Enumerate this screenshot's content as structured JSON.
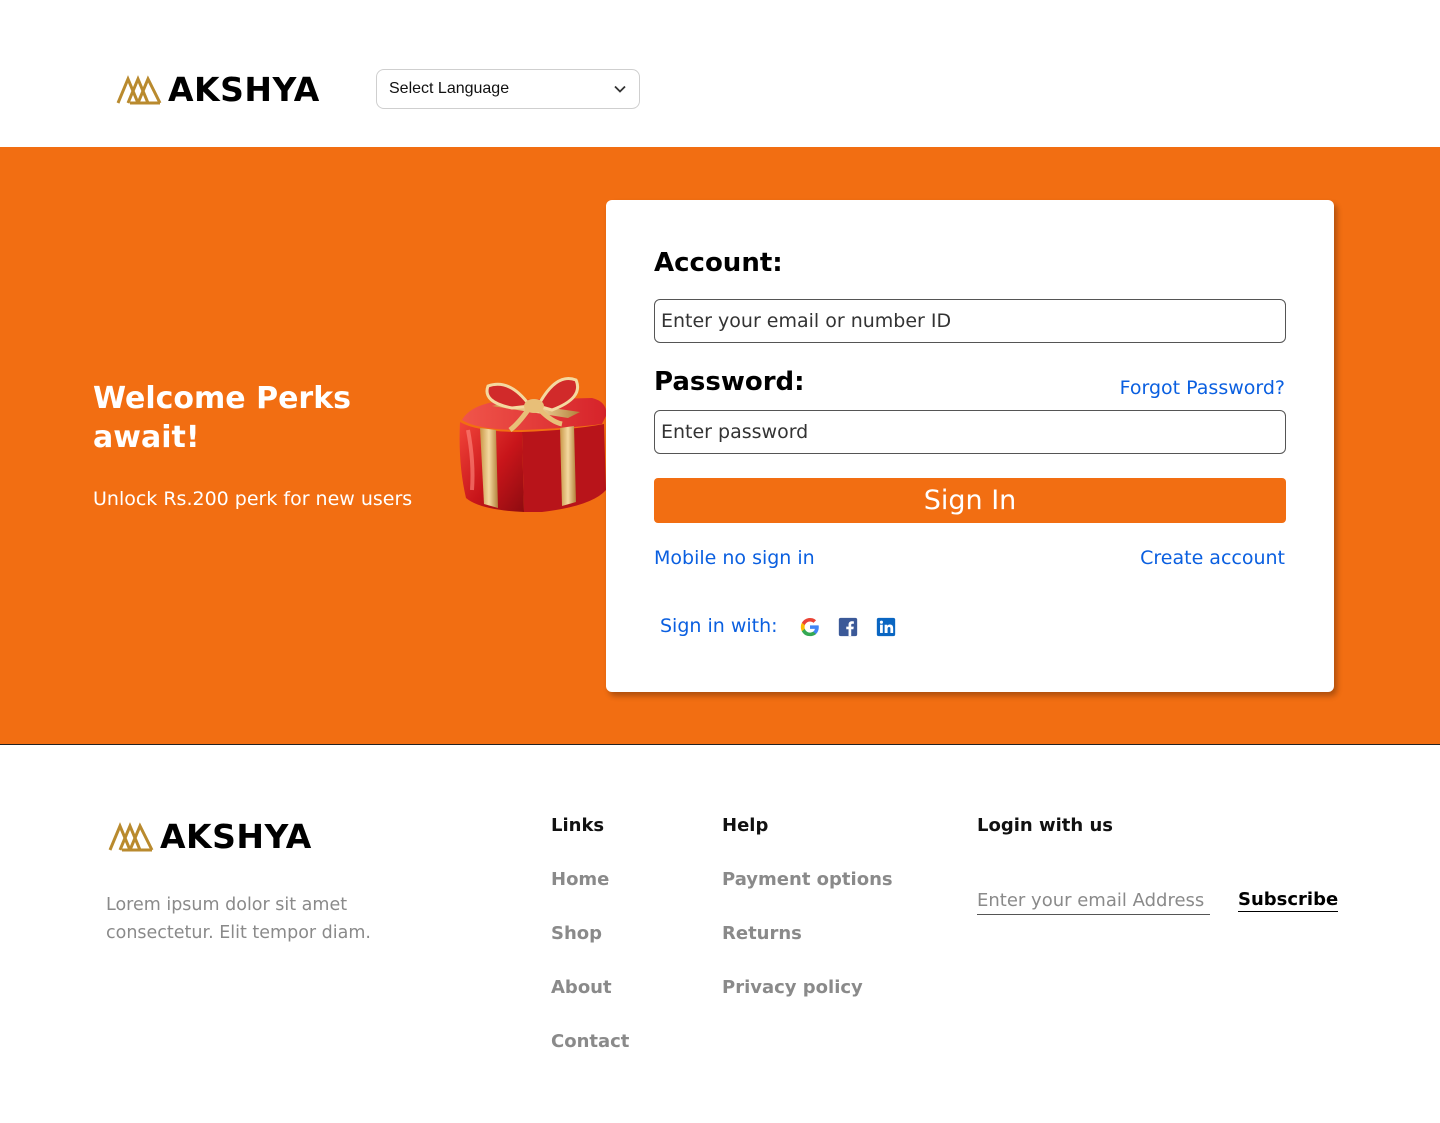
{
  "header": {
    "brand": "AKSHYA",
    "language_select": {
      "selected": "Select Language"
    }
  },
  "hero": {
    "title": "Welcome Perks await!",
    "subtitle": "Unlock Rs.200 perk for new users"
  },
  "login_card": {
    "account_label": "Account:",
    "account_placeholder": "Enter your email or number ID",
    "password_label": "Password:",
    "password_placeholder": "Enter password",
    "forgot_password": "Forgot Password?",
    "sign_in_button": "Sign In",
    "mobile_sign_in": "Mobile no sign in",
    "create_account": "Create account",
    "sign_in_with": "Sign in with:",
    "social_icons": [
      "google-icon",
      "facebook-icon",
      "linkedin-icon"
    ]
  },
  "footer": {
    "brand": "AKSHYA",
    "about": "Lorem ipsum dolor sit amet consectetur. Elit tempor diam.",
    "links_heading": "Links",
    "links": [
      "Home",
      "Shop",
      "About",
      "Contact"
    ],
    "help_heading": "Help",
    "help_links": [
      "Payment options",
      "Returns",
      "Privacy policy"
    ],
    "login_heading": "Login with us",
    "newsletter_placeholder": "Enter your email Address",
    "subscribe": "Subscribe"
  },
  "colors": {
    "accent": "#f26e12",
    "link": "#0a5fe0",
    "logo_gold": "#b98a2e"
  }
}
